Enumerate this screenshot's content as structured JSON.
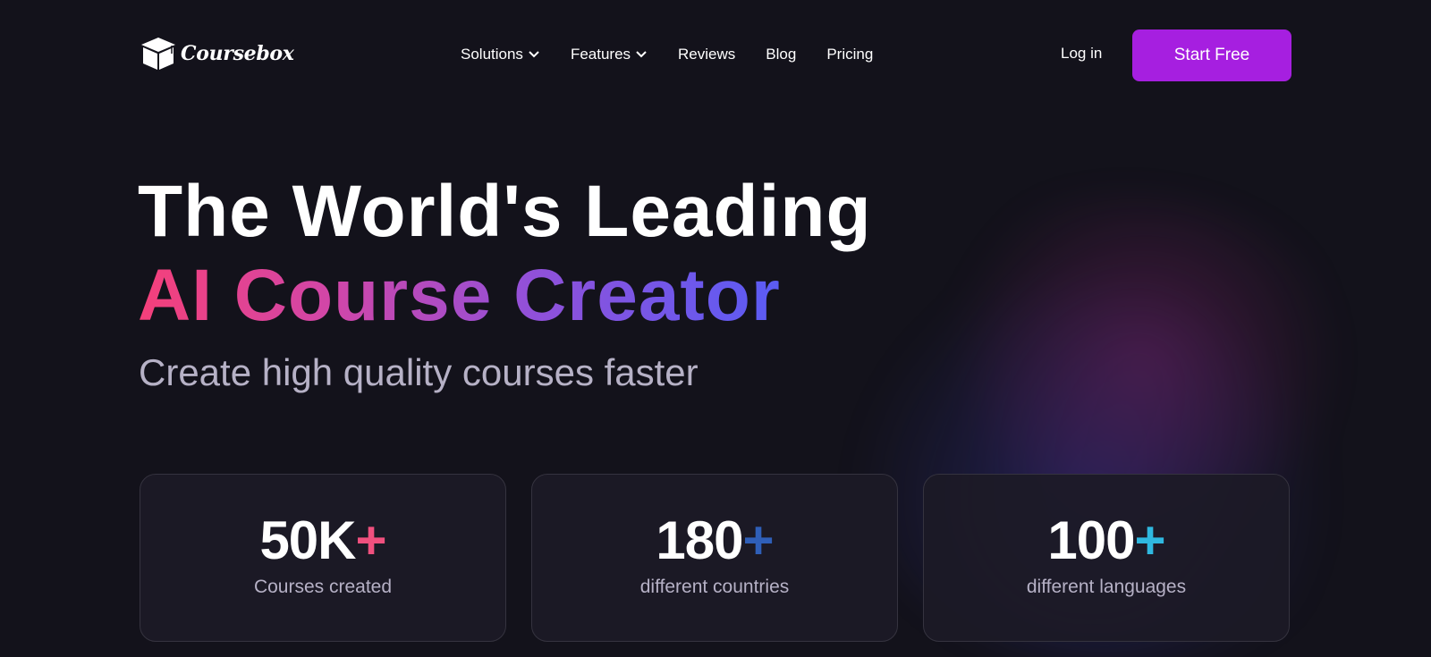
{
  "header": {
    "logo_text": "Coursebox",
    "nav": [
      {
        "label": "Solutions",
        "has_dropdown": true
      },
      {
        "label": "Features",
        "has_dropdown": true
      },
      {
        "label": "Reviews",
        "has_dropdown": false
      },
      {
        "label": "Blog",
        "has_dropdown": false
      },
      {
        "label": "Pricing",
        "has_dropdown": false
      }
    ],
    "login_label": "Log in",
    "cta_label": "Start Free"
  },
  "hero": {
    "headline_line1": "The World's Leading",
    "headline_line2": "AI Course Creator",
    "subheadline": "Create high quality courses faster"
  },
  "stats": [
    {
      "number": "50K",
      "plus": "+",
      "label": "Courses created",
      "plus_color": "#f0507e"
    },
    {
      "number": "180",
      "plus": "+",
      "label": "different countries",
      "plus_color": "#2f5fb8"
    },
    {
      "number": "100",
      "plus": "+",
      "label": "different languages",
      "plus_color": "#2fb8e0"
    }
  ],
  "colors": {
    "background": "#13121b",
    "cta": "#a61fe0",
    "headline_gradient": [
      "#f5407a",
      "#d146a8",
      "#9350d8",
      "#5a5cf5"
    ]
  }
}
